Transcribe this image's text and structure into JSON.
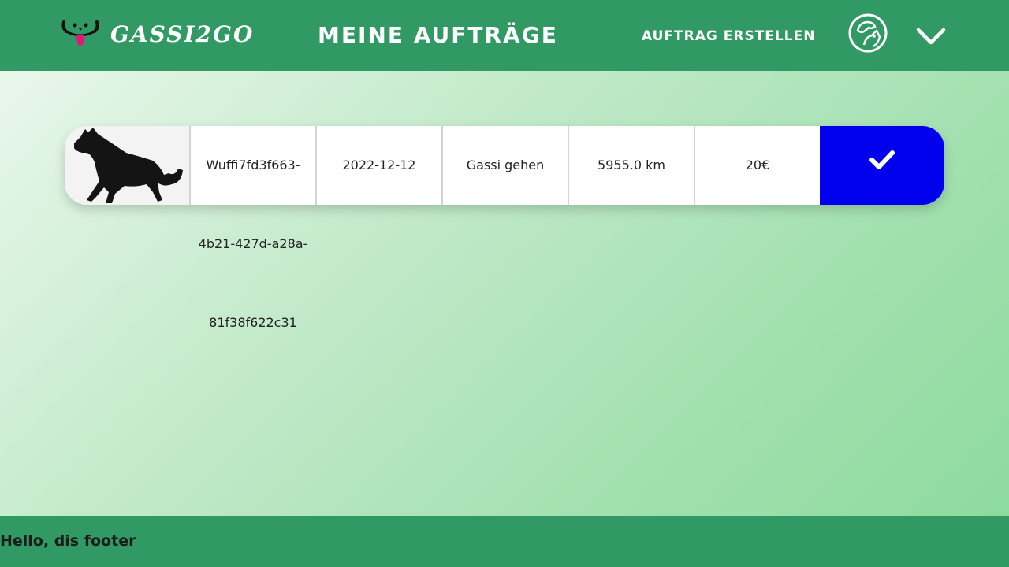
{
  "header": {
    "brand": "GASSI2GO",
    "title": "MEINE AUFTRÄGE",
    "create_order": "AUFTRAG ERSTELLEN",
    "logo_icon": "dog-face-icon",
    "profile_icon": "user-avatar-icon",
    "menu_icon": "chevron-down-icon",
    "bg_color": "#319963"
  },
  "orders": [
    {
      "image_icon": "dog-silhouette-icon",
      "dog_id_lines": [
        "Wuffi7fd3f663-",
        "4b21-427d-a28a-",
        "81f38f622c31"
      ],
      "date": "2022-12-12",
      "service": "Gassi gehen",
      "distance": "5955.0 km",
      "price": "20€",
      "confirm_icon": "checkmark-icon",
      "confirm_color": "#0000ee"
    }
  ],
  "footer": {
    "text": "Hello, dis footer"
  }
}
